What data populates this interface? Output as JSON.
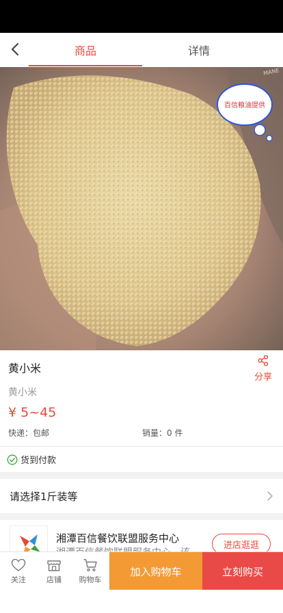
{
  "nav": {
    "tabs": [
      {
        "label": "商品"
      },
      {
        "label": "详情"
      }
    ]
  },
  "hero": {
    "badge_text": "百信粮油提供",
    "corner_text": "MANE"
  },
  "product": {
    "title": "黄小米",
    "share_label": "分享",
    "subtitle": "黄小米",
    "price": "¥ 5~45",
    "shipping": "快递：包邮",
    "sales": "销量：0 件"
  },
  "payment": {
    "cod_label": "货到付款"
  },
  "spec": {
    "label": "请选择1斤装等"
  },
  "store": {
    "name": "湘潭百信餐饮联盟服务中心",
    "desc": "湘潭百信餐饮联盟服务中心，该",
    "visit_label": "进店逛逛"
  },
  "bottom": {
    "follow_label": "关注",
    "shop_label": "店铺",
    "cart_label": "购物车",
    "add_cart_label": "加入购物车",
    "buy_label": "立刻购买"
  },
  "colors": {
    "accent": "#e8483a",
    "cart_button": "#f39a35",
    "buy_button": "#ea4a47"
  }
}
